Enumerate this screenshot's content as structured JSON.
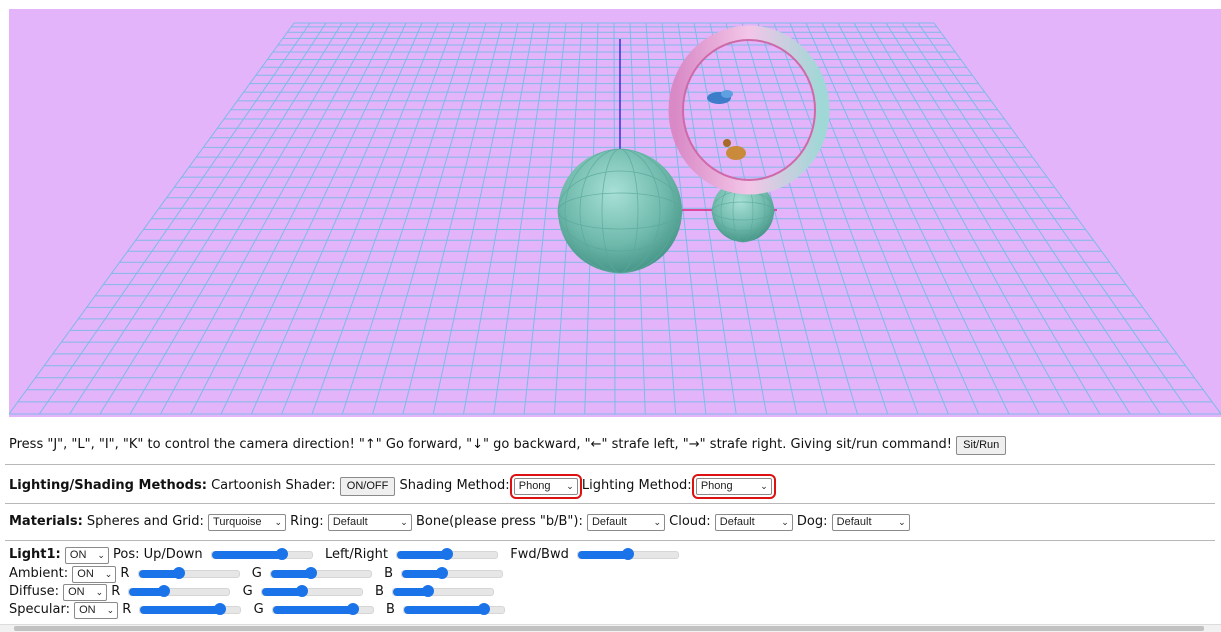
{
  "instructions": {
    "text": "Press \"J\", \"L\", \"I\", \"K\" to control the camera direction!  \"↑\"  Go forward,  \"↓\"  go backward,  \"←\"  strafe left,  \"→\"  strafe right. Giving sit/run command!",
    "sitrun_label": "Sit/Run"
  },
  "lighting": {
    "heading": "Lighting/Shading Methods:",
    "cartoon_label": "Cartoonish Shader:",
    "onoff_label": "ON/OFF",
    "shading_label": "Shading Method:",
    "shading_value": "Phong",
    "lighting_label": "Lighting Method:",
    "lighting_value": "Phong"
  },
  "materials": {
    "heading": "Materials:",
    "spheres_label": "Spheres and Grid:",
    "spheres_value": "Turquoise",
    "ring_label": "Ring:",
    "ring_value": "Default",
    "bone_label": "Bone(please press \"b/B\"):",
    "bone_value": "Default",
    "cloud_label": "Cloud:",
    "cloud_value": "Default",
    "dog_label": "Dog:",
    "dog_value": "Default"
  },
  "light1": {
    "heading": "Light1:",
    "state": "ON",
    "pos_label": "Pos: Up/Down",
    "leftright_label": "Left/Right",
    "fwdbwd_label": "Fwd/Bwd",
    "pos_updown_value": 0.7,
    "pos_leftright_value": 0.5,
    "pos_fwdbwd_value": 0.5,
    "ambient": {
      "label": "Ambient:",
      "state": "ON",
      "r": 0.4,
      "g": 0.4,
      "b": 0.4
    },
    "diffuse": {
      "label": "Diffuse:",
      "state": "ON",
      "r": 0.35,
      "g": 0.4,
      "b": 0.35
    },
    "specular": {
      "label": "Specular:",
      "state": "ON",
      "r": 0.8,
      "g": 0.8,
      "b": 0.8
    },
    "r_label": "R",
    "g_label": "G",
    "b_label": "B"
  },
  "colors": {
    "sky": "#e4b4fb",
    "grid": "#7fb9e8",
    "sphere": "#7fc7b8",
    "ring_outer": "#e9a4d6",
    "ring_inner": "#cf6aa8",
    "accent": "#1a73e8",
    "highlight": "#dd1111"
  }
}
